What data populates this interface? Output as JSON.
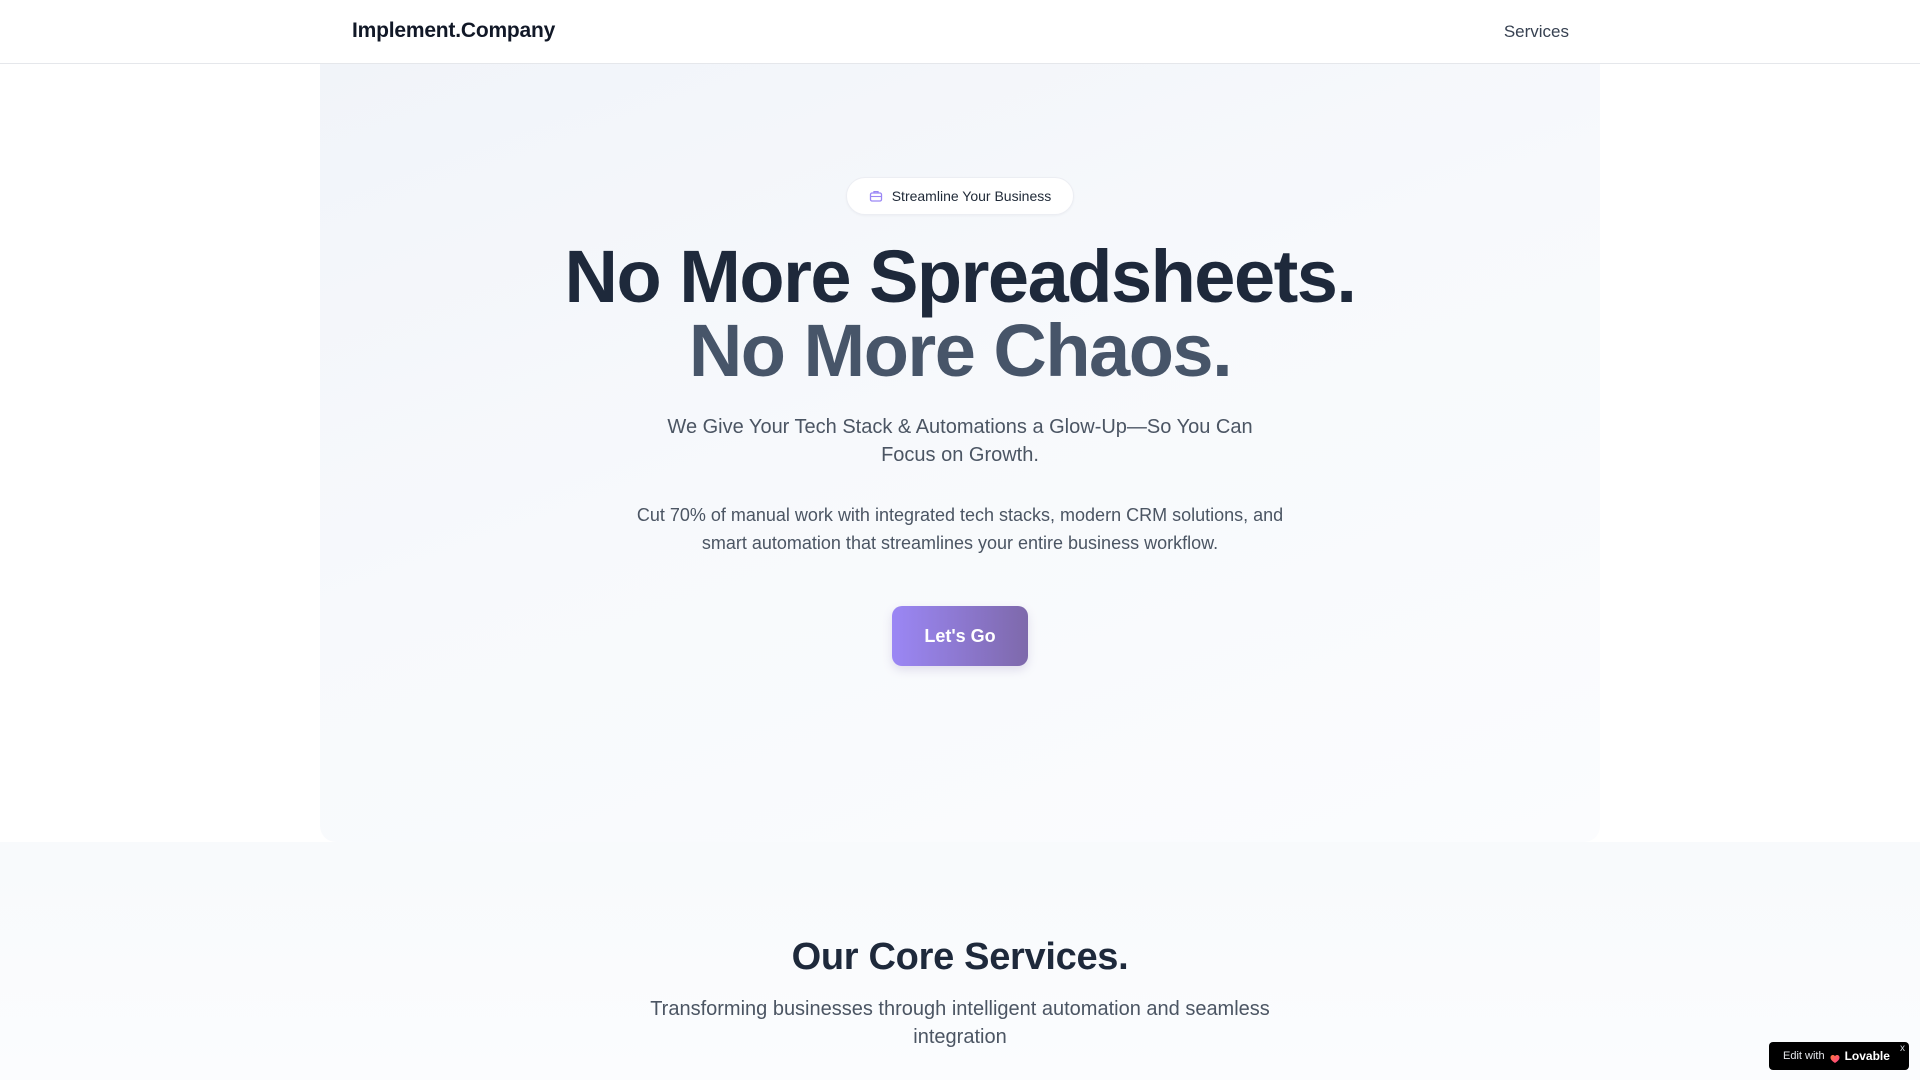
{
  "header": {
    "brand": "Implement.Company",
    "nav": [
      {
        "label": "Services"
      }
    ]
  },
  "hero": {
    "badge": {
      "icon": "briefcase-icon",
      "label": "Streamline Your Business"
    },
    "headline_line1": "No More Spreadsheets.",
    "headline_line2": "No More Chaos.",
    "subheadline": "We Give Your Tech Stack & Automations a Glow-Up—So You Can Focus on Growth.",
    "description": "Cut 70% of manual work with integrated tech stacks, modern CRM solutions, and smart automation that streamlines your entire business workflow.",
    "cta_label": "Let's Go"
  },
  "services": {
    "title": "Our Core Services.",
    "subtitle": "Transforming businesses through intelligent automation and seamless integration"
  },
  "edit_badge": {
    "prefix": "Edit with",
    "brand": "Lovable",
    "close_label": "x"
  },
  "colors": {
    "accent_start": "#9b87f5",
    "accent_end": "#7e69ab",
    "heading": "#1e293b",
    "heading_secondary": "#475569",
    "body": "#4b5563"
  }
}
